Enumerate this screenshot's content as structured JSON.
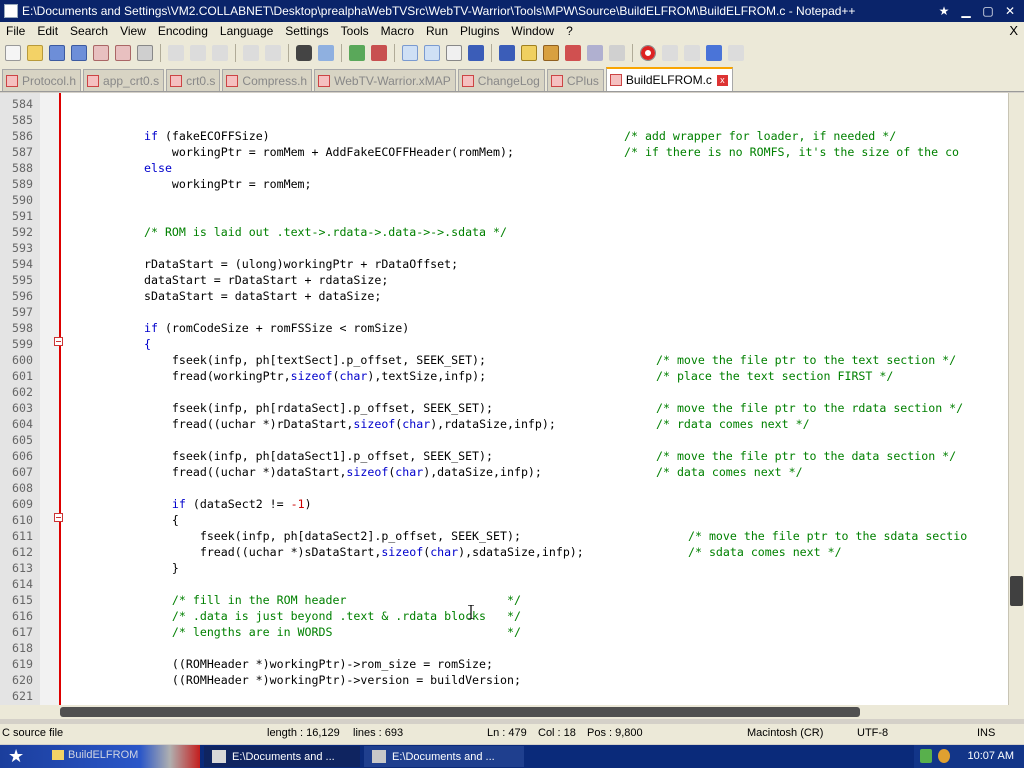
{
  "window": {
    "title": "E:\\Documents and Settings\\VM2.COLLABNET\\Desktop\\prealphaWebTVSrc\\WebTV-Warrior\\Tools\\MPW\\Source\\BuildELFROM\\BuildELFROM.c - Notepad++",
    "close_glyph": "✕",
    "menu_close": "X"
  },
  "menu": [
    "File",
    "Edit",
    "Search",
    "View",
    "Encoding",
    "Language",
    "Settings",
    "Tools",
    "Macro",
    "Run",
    "Plugins",
    "Window",
    "?"
  ],
  "tabs": [
    {
      "label": "Protocol.h",
      "active": false
    },
    {
      "label": "app_crt0.s",
      "active": false
    },
    {
      "label": "crt0.s",
      "active": false
    },
    {
      "label": "Compress.h",
      "active": false
    },
    {
      "label": "WebTV-Warrior.xMAP",
      "active": false
    },
    {
      "label": "ChangeLog",
      "active": false
    },
    {
      "label": "CPlus",
      "active": false
    },
    {
      "label": "BuildELFROM.c",
      "active": true
    }
  ],
  "line_numbers": [
    "584",
    "585",
    "586",
    "587",
    "588",
    "589",
    "590",
    "591",
    "592",
    "593",
    "594",
    "595",
    "596",
    "597",
    "598",
    "599",
    "600",
    "601",
    "602",
    "603",
    "604",
    "605",
    "606",
    "607",
    "608",
    "609",
    "610",
    "611",
    "612",
    "613",
    "614",
    "615",
    "616",
    "617",
    "618",
    "619",
    "620",
    "621"
  ],
  "code": {
    "l586_kw": "if",
    "l586_rest": " (fakeECOFFSize)",
    "l586_cm": "/* add wrapper for loader, if needed */",
    "l587": "    workingPtr = romMem + AddFakeECOFFHeader(romMem);",
    "l587_cm": "/* if there is no ROMFS, it's the size of the co",
    "l588_kw": "else",
    "l589": "    workingPtr = romMem;",
    "l592_cm": "/* ROM is laid out .text->.rdata->.data->->.sdata */",
    "l594": "rDataStart = (ulong)workingPtr + rDataOffset;",
    "l595": "dataStart = rDataStart + rdataSize;",
    "l596": "sDataStart = dataStart + dataSize;",
    "l598_kw": "if",
    "l598_rest": " (romCodeSize + romFSSize < romSize)",
    "l599": "{",
    "l600": "    fseek(infp, ph[textSect].p_offset, SEEK_SET);",
    "l600_cm": "/* move the file ptr to the text section */",
    "l601_a": "    fread(workingPtr,",
    "l601_kw": "sizeof",
    "l601_b": "(",
    "l601_kw2": "char",
    "l601_c": "),textSize,infp);",
    "l601_cm": "/* place the text section FIRST */",
    "l603": "    fseek(infp, ph[rdataSect].p_offset, SEEK_SET);",
    "l603_cm": "/* move the file ptr to the rdata section */",
    "l604_a": "    fread((uchar *)rDataStart,",
    "l604_kw": "sizeof",
    "l604_b": "(",
    "l604_kw2": "char",
    "l604_c": "),rdataSize,infp);",
    "l604_cm": "/* rdata comes next */",
    "l606": "    fseek(infp, ph[dataSect1].p_offset, SEEK_SET);",
    "l606_cm": "/* move the file ptr to the data section */",
    "l607_a": "    fread((uchar *)dataStart,",
    "l607_kw": "sizeof",
    "l607_b": "(",
    "l607_kw2": "char",
    "l607_c": "),dataSize,infp);",
    "l607_cm": "/* data comes next */",
    "l609_kw": "    if",
    "l609_rest": " (dataSect2 != ",
    "l609_nm": "-1",
    "l609_end": ")",
    "l610": "    {",
    "l611": "        fseek(infp, ph[dataSect2].p_offset, SEEK_SET);",
    "l611_cm": "/* move the file ptr to the sdata sectio",
    "l612_a": "        fread((uchar *)sDataStart,",
    "l612_kw": "sizeof",
    "l612_b": "(",
    "l612_kw2": "char",
    "l612_c": "),sdataSize,infp);",
    "l612_cm": "/* sdata comes next */",
    "l613": "    }",
    "l615_cm": "    /* fill in the ROM header                       */",
    "l616_cm": "    /* .data is just beyond .text & .rdata blocks   */",
    "l617_cm": "    /* lengths are in WORDS                         */",
    "l619": "    ((ROMHeader *)workingPtr)->rom_size = romSize;",
    "l620": "    ((ROMHeader *)workingPtr)->version = buildVersion;"
  },
  "status": {
    "filetype": "C source file",
    "length": "length : 16,129",
    "lines": "lines : 693",
    "ln": "Ln : 479",
    "col": "Col : 18",
    "pos": "Pos : 9,800",
    "eol": "Macintosh (CR)",
    "encoding": "UTF-8",
    "mode": "INS"
  },
  "taskbar": {
    "start_label": "BuildELFROM",
    "task1": "E:\\Documents and ...",
    "task2": "E:\\Documents and ...",
    "clock": "10:07 AM"
  },
  "colors": {
    "keyword": "#0000cc",
    "comment": "#008000",
    "number": "#cc0000"
  }
}
